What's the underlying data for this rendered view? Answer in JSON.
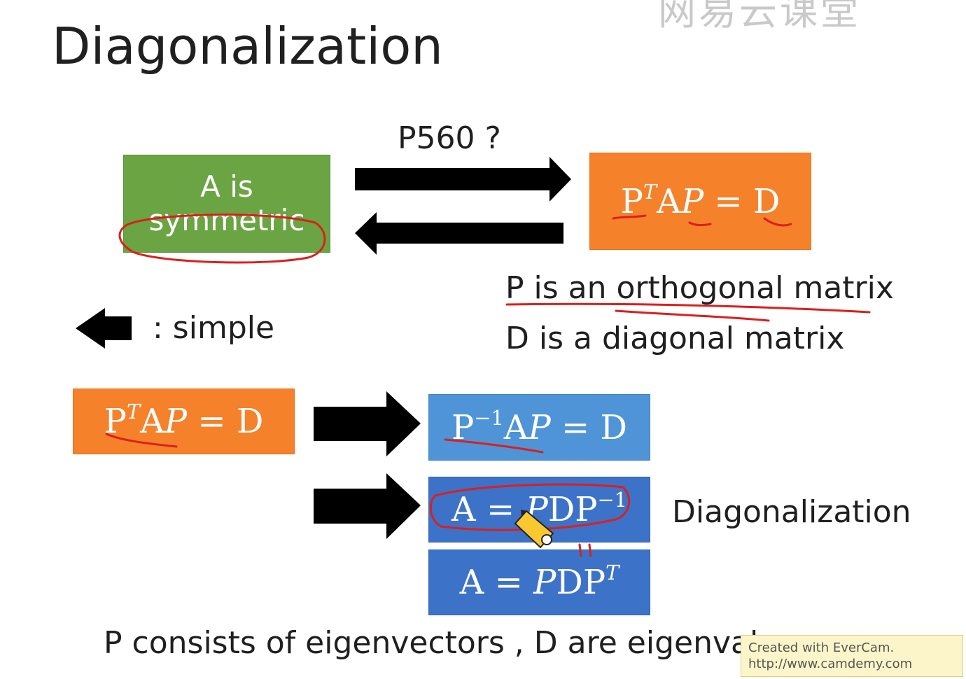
{
  "slide": {
    "title": "Diagonalization",
    "watermark": "网易云课堂",
    "top_arrow_label": "P560 ?",
    "box_symmetric": {
      "line1": "A is",
      "line2": "symmetric"
    },
    "box_top_right": {
      "main": "P",
      "sup": "T",
      "mid": "A",
      "var": "P",
      "rest": " = D"
    },
    "note_orthogonal": "P is an orthogonal matrix",
    "note_diagonal": "D is a diagonal matrix",
    "legend_simple": ": simple",
    "box_bottom_left": {
      "main": "P",
      "sup": "T",
      "mid": "A",
      "var": "P",
      "rest": " = D"
    },
    "box_inverse": {
      "main": "P",
      "sup": "−1",
      "mid": "A",
      "var": "P",
      "rest": " = D"
    },
    "box_diag": {
      "lhs": "A = ",
      "var": "P",
      "mid": "DP",
      "sup": "−1"
    },
    "box_transpose": {
      "lhs": "A = ",
      "var": "P",
      "mid": "DP",
      "sup": "T"
    },
    "diag_label": "Diagonalization",
    "footer": "P consists of eigenvectors , D are eigenvalues"
  },
  "overlay": {
    "line1": "Created with EverCam.",
    "line2": "http://www.camdemy.com"
  },
  "colors": {
    "green": "#6aa443",
    "orange": "#f5812a",
    "light_blue": "#4f94d6",
    "blue": "#3d72c9",
    "annotation_red": "#d9201f"
  }
}
